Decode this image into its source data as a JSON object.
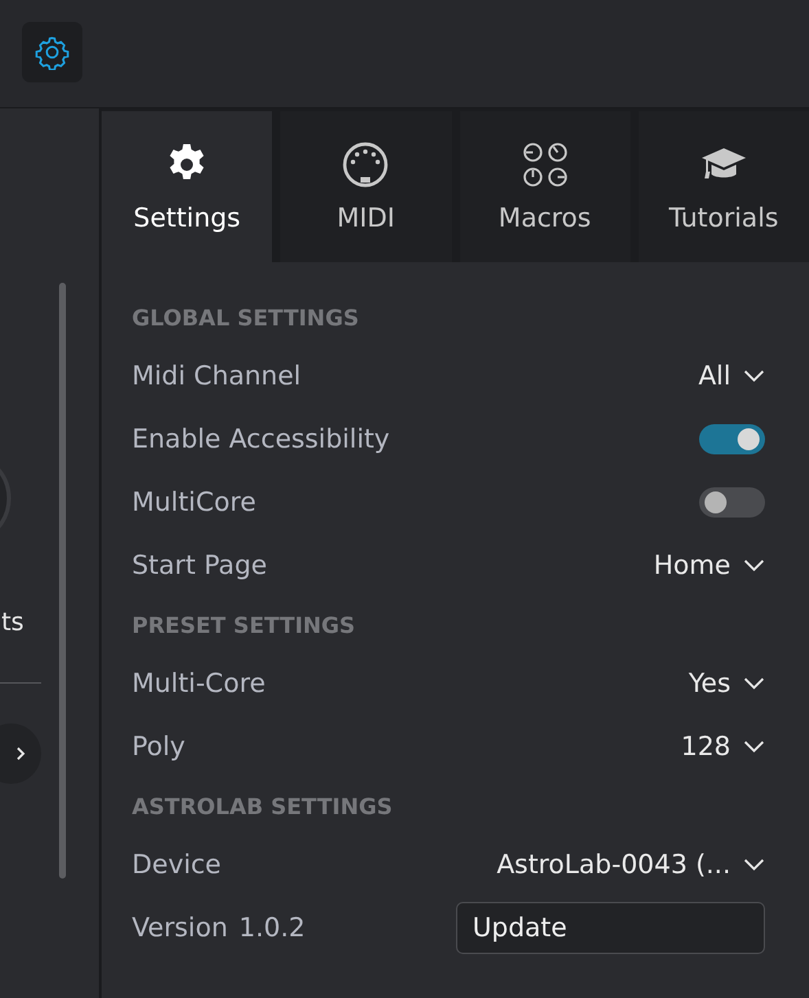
{
  "left_panel": {
    "label_fragment": "ts"
  },
  "tabs": [
    {
      "label": "Settings",
      "kind": "gear",
      "selected": true
    },
    {
      "label": "MIDI",
      "kind": "midi",
      "selected": false
    },
    {
      "label": "Macros",
      "kind": "knobs",
      "selected": false
    },
    {
      "label": "Tutorials",
      "kind": "cap",
      "selected": false
    }
  ],
  "sections": [
    {
      "title": "GLOBAL SETTINGS",
      "rows": [
        {
          "kind": "dropdown",
          "label": "Midi Channel",
          "value": "All"
        },
        {
          "kind": "toggle",
          "label": "Enable Accessibility",
          "on": true
        },
        {
          "kind": "toggle",
          "label": "MultiCore",
          "on": false
        },
        {
          "kind": "dropdown",
          "label": "Start Page",
          "value": "Home"
        }
      ]
    },
    {
      "title": "PRESET SETTINGS",
      "rows": [
        {
          "kind": "dropdown",
          "label": "Multi-Core",
          "value": "Yes"
        },
        {
          "kind": "dropdown",
          "label": "Poly",
          "value": "128"
        }
      ]
    },
    {
      "title": "ASTROLAB SETTINGS",
      "rows": [
        {
          "kind": "dropdown",
          "label": "Device",
          "value": "AstroLab-0043 (..."
        },
        {
          "kind": "version",
          "label": "Version",
          "value": "1.0.2",
          "button": "Update"
        }
      ]
    }
  ]
}
